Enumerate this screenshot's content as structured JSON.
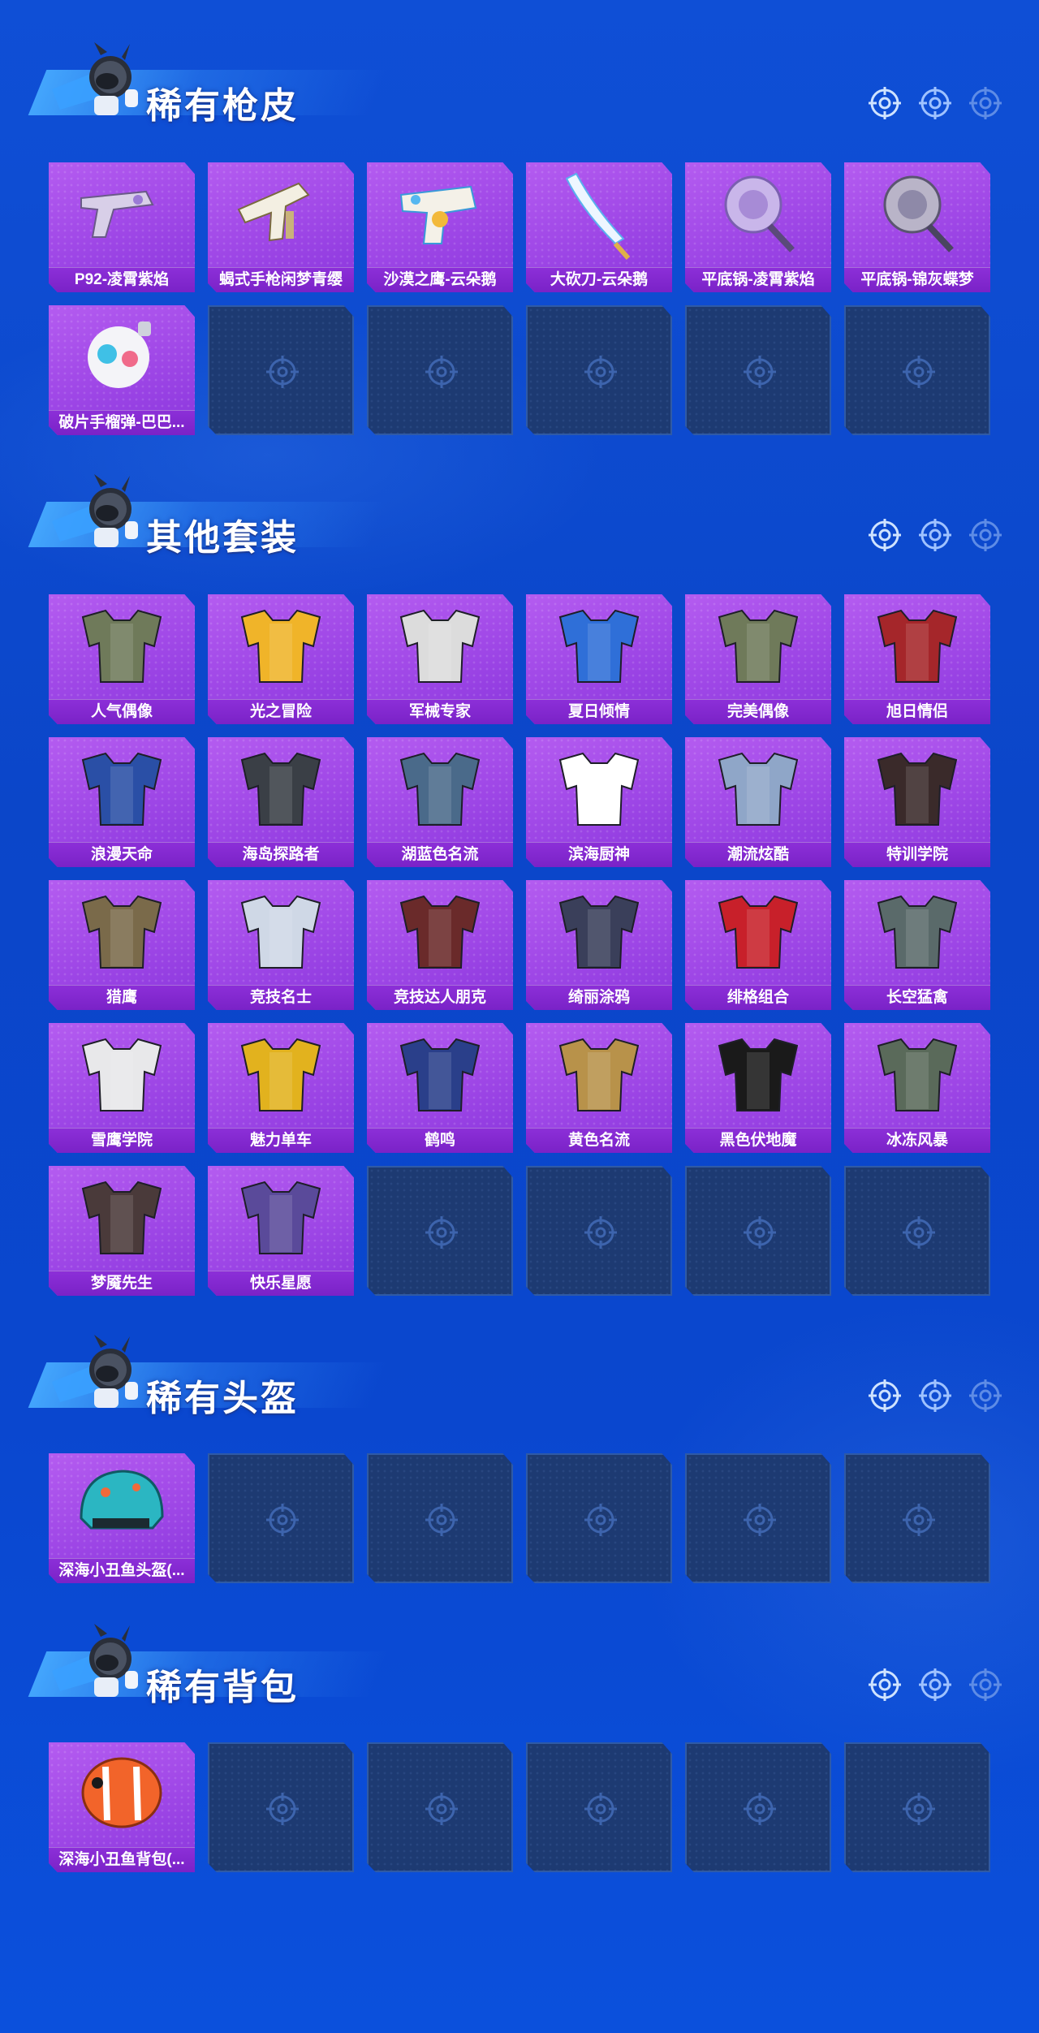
{
  "sections": [
    {
      "title": "稀有枪皮",
      "items": [
        "P92-凌霄紫焰",
        "蝎式手枪闲梦青缨",
        "沙漠之鹰-云朵鹅",
        "大砍刀-云朵鹅",
        "平底锅-凌霄紫焰",
        "平底锅-锦灰蝶梦",
        "破片手榴弹-巴巴..."
      ]
    },
    {
      "title": "其他套装",
      "items": [
        "人气偶像",
        "光之冒险",
        "军械专家",
        "夏日倾情",
        "完美偶像",
        "旭日情侣",
        "浪漫天命",
        "海岛探路者",
        "湖蓝色名流",
        "滨海厨神",
        "潮流炫酷",
        "特训学院",
        "猎鹰",
        "竞技名士",
        "竞技达人朋克",
        "绮丽涂鸦",
        "绯格组合",
        "长空猛禽",
        "雪鹰学院",
        "魅力单车",
        "鹤鸣",
        "黄色名流",
        "黑色伏地魔",
        "冰冻风暴",
        "梦魇先生",
        "快乐星愿"
      ]
    },
    {
      "title": "稀有头盔",
      "items": [
        "深海小丑鱼头盔(..."
      ]
    },
    {
      "title": "稀有背包",
      "items": [
        "深海小丑鱼背包(..."
      ]
    }
  ],
  "icons": {
    "section_mascot": "mascot-soldier-icon",
    "target": "crosshair-target-icon",
    "empty_slot": "crosshair-placeholder-icon"
  },
  "colors": {
    "accent": "#ffffff",
    "card": "#a24ae8",
    "label": "#7a22c7",
    "empty": "#1d3a72",
    "bg": "#0b46c9"
  }
}
